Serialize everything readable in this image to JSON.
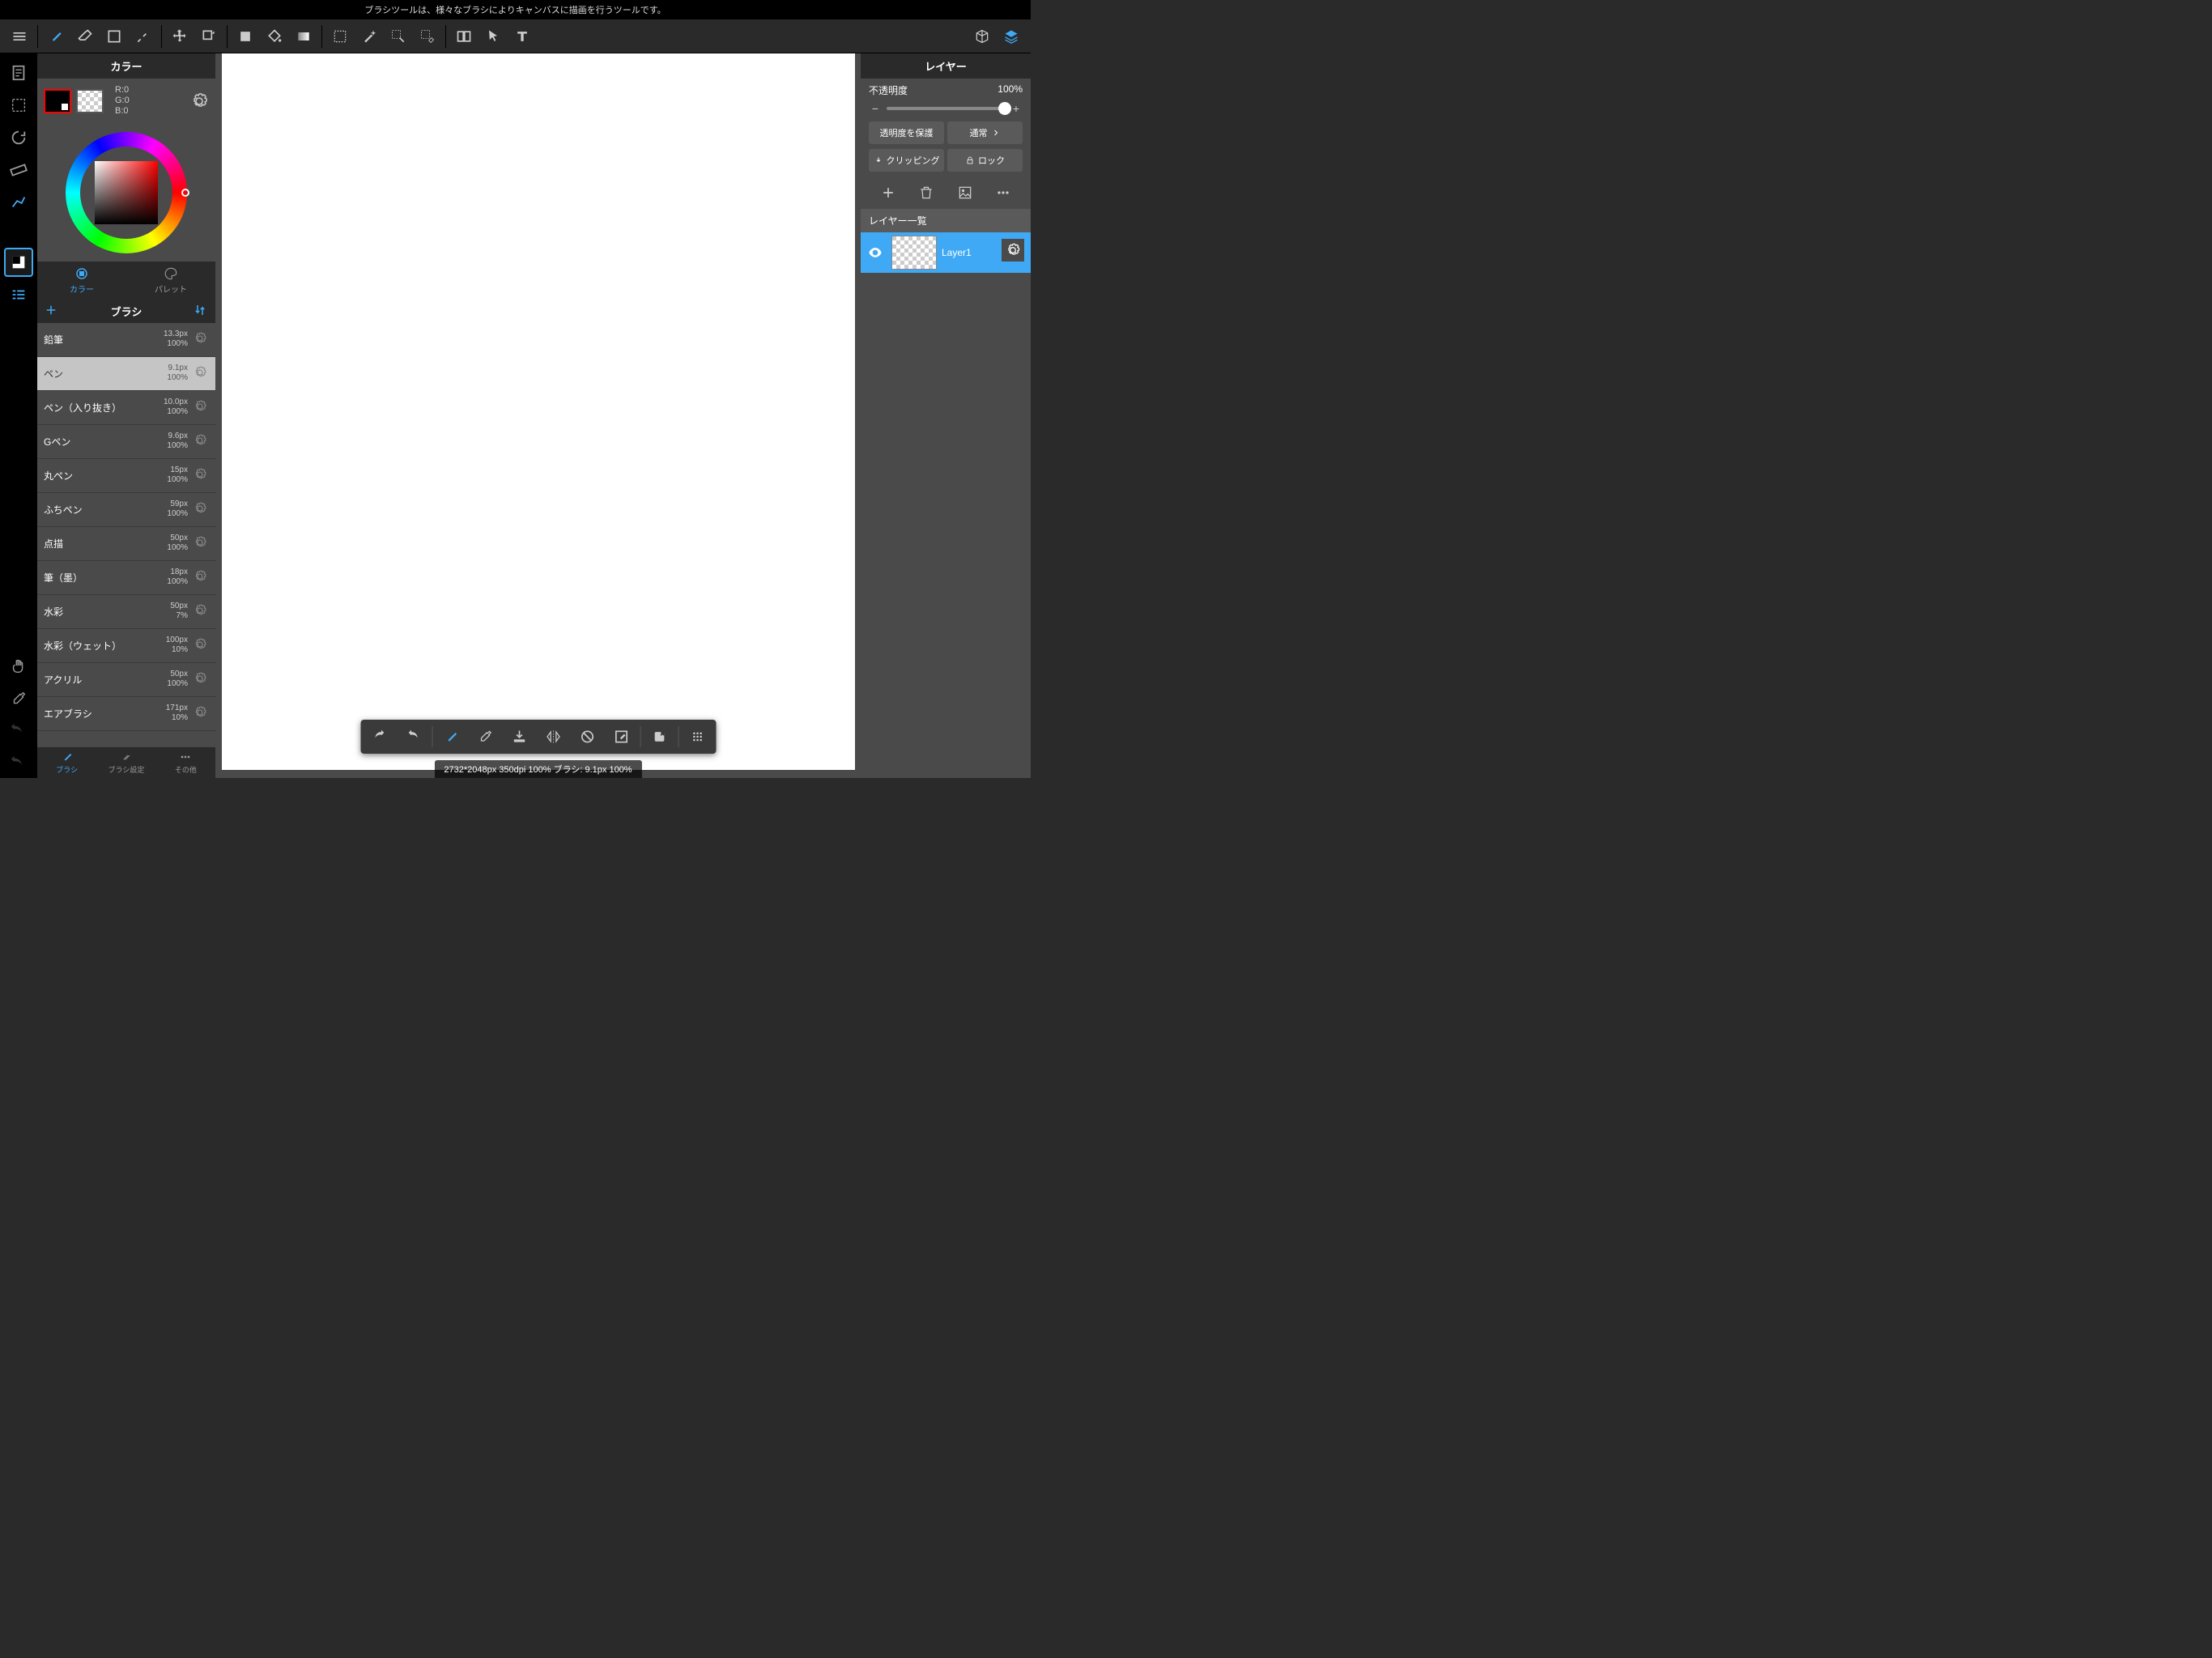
{
  "tooltip": "ブラシツールは、様々なブラシによりキャンバスに描画を行うツールです。",
  "left_panel": {
    "color_title": "カラー",
    "rgb": {
      "r": "R:0",
      "g": "G:0",
      "b": "B:0"
    },
    "color_tab": "カラー",
    "palette_tab": "パレット",
    "brush_title": "ブラシ",
    "brushes": [
      {
        "name": "鉛筆",
        "size": "13.3px",
        "opacity": "100%",
        "selected": false
      },
      {
        "name": "ペン",
        "size": "9.1px",
        "opacity": "100%",
        "selected": true
      },
      {
        "name": "ペン（入り抜き）",
        "size": "10.0px",
        "opacity": "100%",
        "selected": false
      },
      {
        "name": "Gペン",
        "size": "9.6px",
        "opacity": "100%",
        "selected": false
      },
      {
        "name": "丸ペン",
        "size": "15px",
        "opacity": "100%",
        "selected": false
      },
      {
        "name": "ふちペン",
        "size": "59px",
        "opacity": "100%",
        "selected": false
      },
      {
        "name": "点描",
        "size": "50px",
        "opacity": "100%",
        "selected": false
      },
      {
        "name": "筆（墨）",
        "size": "18px",
        "opacity": "100%",
        "selected": false
      },
      {
        "name": "水彩",
        "size": "50px",
        "opacity": "7%",
        "selected": false
      },
      {
        "name": "水彩（ウェット）",
        "size": "100px",
        "opacity": "10%",
        "selected": false
      },
      {
        "name": "アクリル",
        "size": "50px",
        "opacity": "100%",
        "selected": false
      },
      {
        "name": "エアブラシ",
        "size": "171px",
        "opacity": "10%",
        "selected": false
      }
    ],
    "footer_tabs": {
      "brush": "ブラシ",
      "settings": "ブラシ設定",
      "other": "その他"
    }
  },
  "right_panel": {
    "title": "レイヤー",
    "opacity_label": "不透明度",
    "opacity_value": "100%",
    "protect_alpha": "透明度を保護",
    "blend_mode": "通常",
    "clipping": "クリッピング",
    "lock": "ロック",
    "list_header": "レイヤー一覧",
    "layers": [
      {
        "name": "Layer1"
      }
    ]
  },
  "status": "2732*2048px 350dpi 100% ブラシ: 9.1px 100%"
}
